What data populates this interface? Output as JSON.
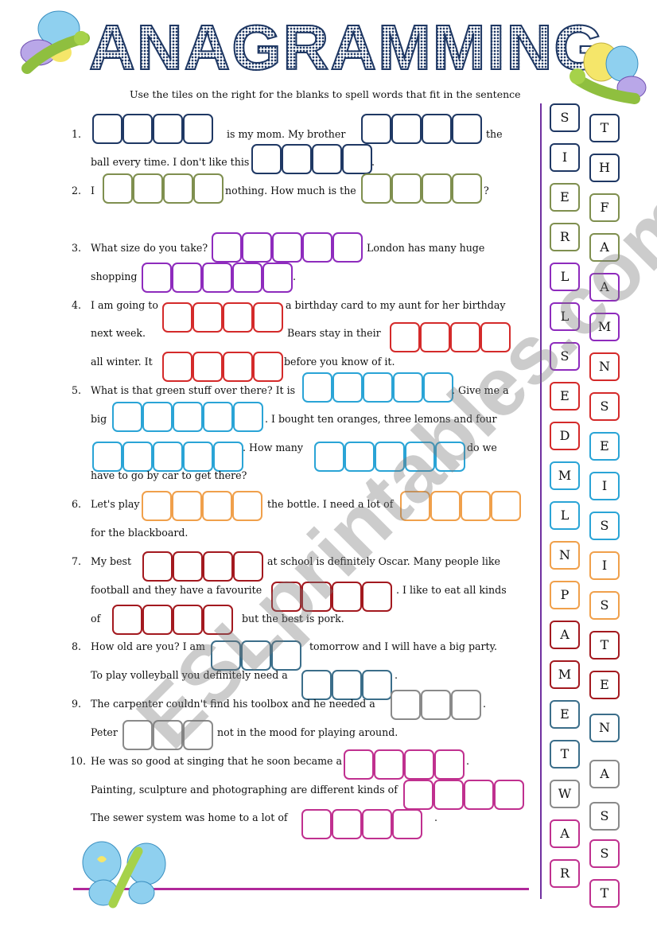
{
  "title": "ANAGRAMMING",
  "instructions": "Use the tiles on the right for the blanks to spell words that fit in the sentence",
  "watermark": "ESLprintables.com",
  "colors": {
    "navy": "#1f3864",
    "olive": "#7f8f4f",
    "purple": "#8e2bbd",
    "red": "#d42a2a",
    "cyan": "#2aa4d6",
    "orange": "#f0a04b",
    "darkred": "#a3191f",
    "teal": "#3b6e8a",
    "gray": "#8a8a8a",
    "magenta": "#c0308f",
    "divider": "#7030a0"
  },
  "questions": [
    {
      "number": "1.",
      "texts": [
        "is my mom.  My brother",
        "the",
        "ball every time. I don't like this",
        "."
      ],
      "blanks": [
        {
          "letters": 4,
          "color": "navy"
        },
        {
          "letters": 4,
          "color": "navy"
        },
        {
          "letters": 4,
          "color": "navy"
        }
      ]
    },
    {
      "number": "2.",
      "texts": [
        "I",
        "nothing. How much is the",
        "?"
      ],
      "blanks": [
        {
          "letters": 4,
          "color": "olive"
        },
        {
          "letters": 4,
          "color": "olive"
        }
      ]
    },
    {
      "number": "3.",
      "texts": [
        "What size do you take?",
        "London has many huge",
        "shopping",
        "."
      ],
      "blanks": [
        {
          "letters": 5,
          "color": "purple"
        },
        {
          "letters": 5,
          "color": "purple"
        }
      ]
    },
    {
      "number": "4.",
      "texts": [
        "I am going to",
        "a birthday card to my aunt for her birthday",
        "next week.",
        "Bears stay in their",
        "all winter. It",
        "before you know of it."
      ],
      "blanks": [
        {
          "letters": 4,
          "color": "red"
        },
        {
          "letters": 4,
          "color": "red"
        },
        {
          "letters": 4,
          "color": "red"
        }
      ]
    },
    {
      "number": "5.",
      "texts": [
        "What is that green stuff over there? It is",
        ". Give me a",
        "big",
        ". I bought ten oranges, three lemons and four",
        ".  How many",
        "do we",
        "have to go by car to get there?"
      ],
      "blanks": [
        {
          "letters": 5,
          "color": "cyan"
        },
        {
          "letters": 5,
          "color": "cyan"
        },
        {
          "letters": 5,
          "color": "cyan"
        },
        {
          "letters": 5,
          "color": "cyan"
        }
      ]
    },
    {
      "number": "6.",
      "texts": [
        "Let's play",
        "the bottle. I need a lot of",
        "for the blackboard."
      ],
      "blanks": [
        {
          "letters": 4,
          "color": "orange"
        },
        {
          "letters": 4,
          "color": "orange"
        }
      ]
    },
    {
      "number": "7.",
      "texts": [
        "My best",
        "at school is definitely Oscar. Many people like",
        "football and they have a favourite",
        ". I like to eat all kinds",
        "of",
        "but the best is pork."
      ],
      "blanks": [
        {
          "letters": 4,
          "color": "darkred"
        },
        {
          "letters": 4,
          "color": "darkred"
        },
        {
          "letters": 4,
          "color": "darkred"
        }
      ]
    },
    {
      "number": "8.",
      "texts": [
        "How old are you? I am",
        "tomorrow and I will have a big party.",
        "To play volleyball you definitely need a",
        "."
      ],
      "blanks": [
        {
          "letters": 3,
          "color": "teal"
        },
        {
          "letters": 3,
          "color": "teal"
        }
      ]
    },
    {
      "number": "9.",
      "texts": [
        "The carpenter couldn't find his toolbox and he needed a",
        ".",
        "Peter",
        "not in the mood for playing around."
      ],
      "blanks": [
        {
          "letters": 3,
          "color": "gray"
        },
        {
          "letters": 3,
          "color": "gray"
        }
      ]
    },
    {
      "number": "10.",
      "texts": [
        "He was so good at singing that he soon became a",
        ".",
        "Painting, sculpture and photographing are different kinds of",
        "The sewer system was home to a lot of",
        "."
      ],
      "blanks": [
        {
          "letters": 4,
          "color": "magenta"
        },
        {
          "letters": 4,
          "color": "magenta"
        },
        {
          "letters": 4,
          "color": "magenta"
        }
      ]
    }
  ],
  "tiles": {
    "left": [
      {
        "letter": "S",
        "color": "navy"
      },
      {
        "letter": "I",
        "color": "navy"
      },
      {
        "letter": "E",
        "color": "olive"
      },
      {
        "letter": "R",
        "color": "olive"
      },
      {
        "letter": "L",
        "color": "purple"
      },
      {
        "letter": "L",
        "color": "purple"
      },
      {
        "letter": "S",
        "color": "purple"
      },
      {
        "letter": "E",
        "color": "red"
      },
      {
        "letter": "D",
        "color": "red"
      },
      {
        "letter": "M",
        "color": "cyan"
      },
      {
        "letter": "L",
        "color": "cyan"
      },
      {
        "letter": "N",
        "color": "orange"
      },
      {
        "letter": "P",
        "color": "orange"
      },
      {
        "letter": "A",
        "color": "darkred"
      },
      {
        "letter": "M",
        "color": "darkred"
      },
      {
        "letter": "E",
        "color": "teal"
      },
      {
        "letter": "T",
        "color": "teal"
      },
      {
        "letter": "W",
        "color": "gray"
      },
      {
        "letter": "A",
        "color": "magenta"
      },
      {
        "letter": "R",
        "color": "magenta"
      }
    ],
    "right": [
      {
        "letter": "T",
        "color": "navy"
      },
      {
        "letter": "H",
        "color": "navy"
      },
      {
        "letter": "F",
        "color": "olive"
      },
      {
        "letter": "A",
        "color": "olive"
      },
      {
        "letter": "A",
        "color": "purple"
      },
      {
        "letter": "M",
        "color": "purple"
      },
      {
        "letter": "N",
        "color": "red"
      },
      {
        "letter": "S",
        "color": "red"
      },
      {
        "letter": "E",
        "color": "cyan"
      },
      {
        "letter": "I",
        "color": "cyan"
      },
      {
        "letter": "S",
        "color": "cyan"
      },
      {
        "letter": "I",
        "color": "orange"
      },
      {
        "letter": "S",
        "color": "orange"
      },
      {
        "letter": "T",
        "color": "darkred"
      },
      {
        "letter": "E",
        "color": "darkred"
      },
      {
        "letter": "N",
        "color": "teal"
      },
      {
        "letter": "A",
        "color": "gray"
      },
      {
        "letter": "S",
        "color": "gray"
      },
      {
        "letter": "S",
        "color": "magenta"
      },
      {
        "letter": "T",
        "color": "magenta"
      }
    ]
  }
}
